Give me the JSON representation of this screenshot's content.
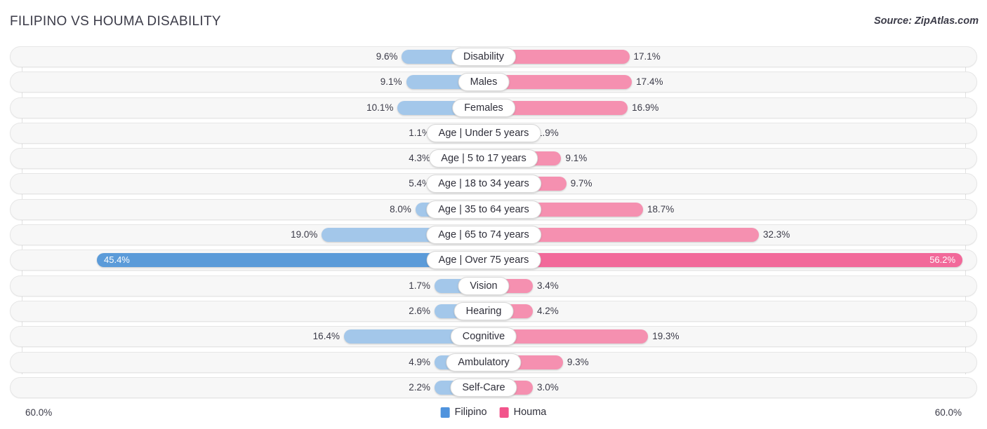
{
  "header": {
    "title": "FILIPINO VS HOUMA DISABILITY",
    "source": "Source: ZipAtlas.com"
  },
  "axis": {
    "left_max_label": "60.0%",
    "right_max_label": "60.0%",
    "max_value": 60.0
  },
  "legend": [
    {
      "label": "Filipino",
      "color": "#4f93dd",
      "icon": "square-swatch"
    },
    {
      "label": "Houma",
      "color": "#f2548b",
      "icon": "square-swatch"
    }
  ],
  "colors": {
    "left_bar": "#a3c7ea",
    "right_bar": "#f590b0",
    "left_bar_highlight": "#5b9bd9",
    "right_bar_highlight": "#f2699a",
    "track": "#f7f7f7",
    "gridline": "#e2e2e2",
    "text": "#3b3b48"
  },
  "chart_data": {
    "type": "bar",
    "title": "FILIPINO VS HOUMA DISABILITY",
    "subtitle": "",
    "orientation": "horizontal-diverging",
    "xlabel": "",
    "ylabel": "",
    "xlim": [
      -60.0,
      60.0
    ],
    "grid": true,
    "legend_position": "bottom-center",
    "categories": [
      "Disability",
      "Males",
      "Females",
      "Age | Under 5 years",
      "Age | 5 to 17 years",
      "Age | 18 to 34 years",
      "Age | 35 to 64 years",
      "Age | 65 to 74 years",
      "Age | Over 75 years",
      "Vision",
      "Hearing",
      "Cognitive",
      "Ambulatory",
      "Self-Care"
    ],
    "series": [
      {
        "name": "Filipino",
        "side": "left",
        "values": [
          9.6,
          9.1,
          10.1,
          1.1,
          4.3,
          5.4,
          8.0,
          19.0,
          45.4,
          1.7,
          2.6,
          16.4,
          4.9,
          2.2
        ],
        "labels": [
          "9.6%",
          "9.1%",
          "10.1%",
          "1.1%",
          "4.3%",
          "5.4%",
          "8.0%",
          "19.0%",
          "45.4%",
          "1.7%",
          "2.6%",
          "16.4%",
          "4.9%",
          "2.2%"
        ]
      },
      {
        "name": "Houma",
        "side": "right",
        "values": [
          17.1,
          17.4,
          16.9,
          1.9,
          9.1,
          9.7,
          18.7,
          32.3,
          56.2,
          3.4,
          4.2,
          19.3,
          9.3,
          3.0
        ],
        "labels": [
          "17.1%",
          "17.4%",
          "16.9%",
          "1.9%",
          "9.1%",
          "9.7%",
          "18.7%",
          "32.3%",
          "56.2%",
          "3.4%",
          "4.2%",
          "19.3%",
          "9.3%",
          "3.0%"
        ]
      }
    ],
    "highlighted_rows": [
      8
    ]
  }
}
